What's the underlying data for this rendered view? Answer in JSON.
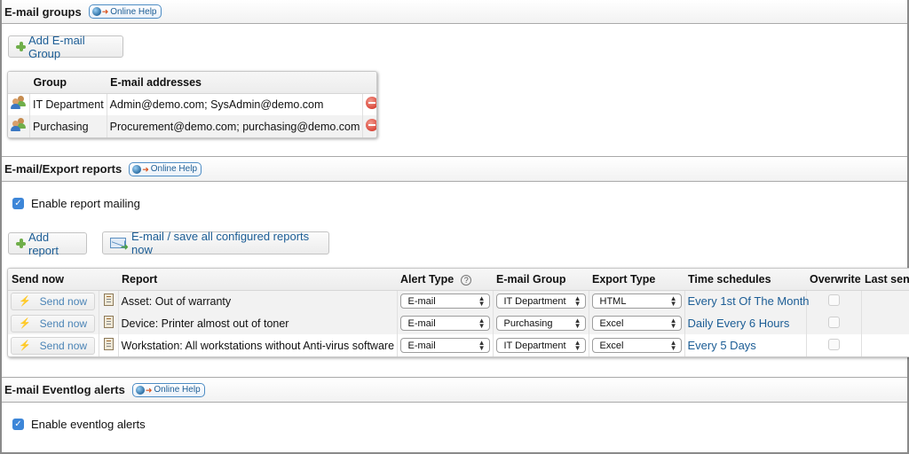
{
  "email_groups": {
    "title": "E-mail groups",
    "help_label": "Online Help",
    "add_button_label": "Add E-mail Group",
    "columns": [
      "Group",
      "E-mail addresses"
    ],
    "rows": [
      {
        "group": "IT Department",
        "addresses": "Admin@demo.com; SysAdmin@demo.com"
      },
      {
        "group": "Purchasing",
        "addresses": "Procurement@demo.com; purchasing@demo.com"
      }
    ]
  },
  "reports": {
    "title": "E-mail/Export reports",
    "help_label": "Online Help",
    "enable_label": "Enable report mailing",
    "enable_checked": true,
    "add_button_label": "Add report",
    "send_all_label": "E-mail / save all configured reports now",
    "columns": [
      "Send now",
      "Report",
      "Alert Type",
      "E-mail Group",
      "Export Type",
      "Time schedules",
      "Overwrite",
      "Last sent"
    ],
    "alert_help": "?",
    "rows": [
      {
        "send_label": "Send now",
        "report": "Asset: Out of warranty",
        "alert_type": "E-mail",
        "group": "IT Department",
        "export": "HTML",
        "schedule": "Every 1st Of The Month",
        "overwrite": false
      },
      {
        "send_label": "Send now",
        "report": "Device: Printer almost out of toner",
        "alert_type": "E-mail",
        "group": "Purchasing",
        "export": "Excel",
        "schedule": "Daily Every 6 Hours",
        "overwrite": false
      },
      {
        "send_label": "Send now",
        "report": "Workstation: All workstations without Anti-virus software",
        "alert_type": "E-mail",
        "group": "IT Department",
        "export": "Excel",
        "schedule": "Every 5 Days",
        "overwrite": false
      }
    ]
  },
  "eventlog": {
    "title": "E-mail Eventlog alerts",
    "help_label": "Online Help",
    "enable_label": "Enable eventlog alerts",
    "enable_checked": true
  }
}
